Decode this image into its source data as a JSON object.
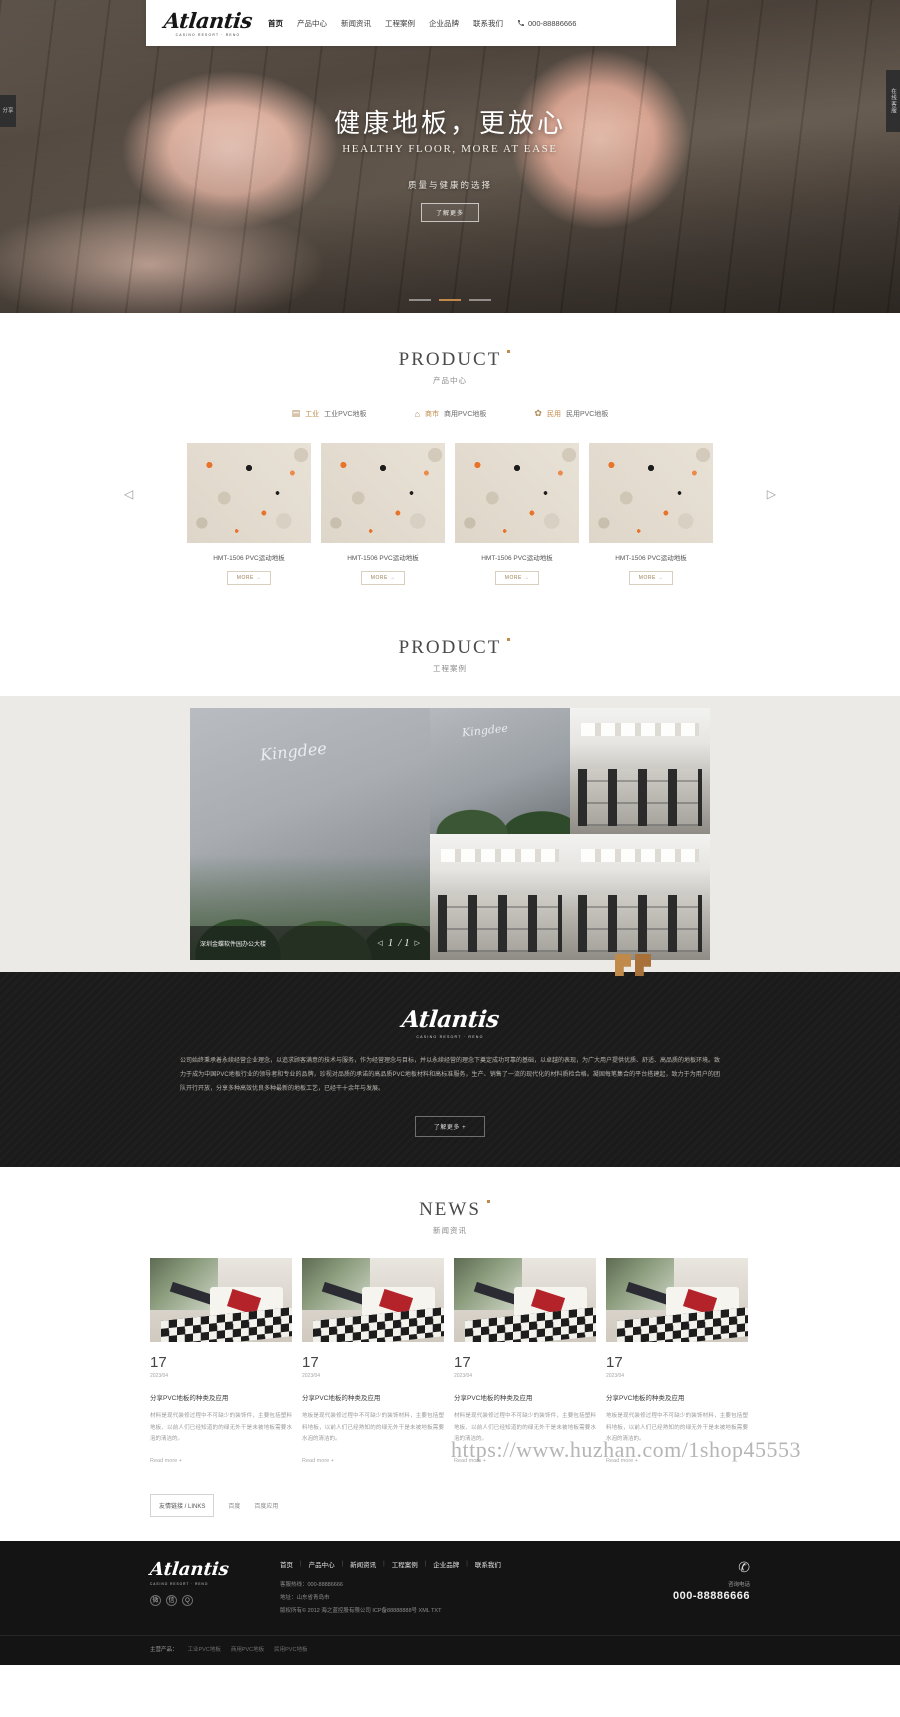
{
  "header": {
    "logo_word": "Atlantis",
    "logo_sub": "CASINO RESORT · RENO",
    "nav": [
      {
        "label": "首页",
        "active": true
      },
      {
        "label": "产品中心",
        "active": false
      },
      {
        "label": "新闻资讯",
        "active": false
      },
      {
        "label": "工程案例",
        "active": false
      },
      {
        "label": "企业品牌",
        "active": false
      },
      {
        "label": "联系我们",
        "active": false
      }
    ],
    "phone": "000-88886666",
    "phone_icon": "phone-icon"
  },
  "side": {
    "share_label": "分享",
    "service_label": "在线客服"
  },
  "hero": {
    "title_cn": "健康地板，更放心",
    "title_en": "HEALTHY FLOOR, MORE AT EASE",
    "subtitle": "质量与健康的选择",
    "button": "了解更多",
    "slides": 3,
    "active_slide": 1
  },
  "product": {
    "title_en": "PRODUCT",
    "title_cn": "产品中心",
    "categories": [
      {
        "icon": "factory-icon",
        "glyph": "▤",
        "tag": "工业",
        "label": "工业PVC地板"
      },
      {
        "icon": "store-icon",
        "glyph": "⌂",
        "tag": "商市",
        "label": "商用PVC地板"
      },
      {
        "icon": "home-icon",
        "glyph": "✿",
        "tag": "民用",
        "label": "民用PVC地板"
      }
    ],
    "items": [
      {
        "title": "HMT-1506 PVC运动地板",
        "more": "MORE  →"
      },
      {
        "title": "HMT-1506 PVC运动地板",
        "more": "MORE  →"
      },
      {
        "title": "HMT-1506 PVC运动地板",
        "more": "MORE  →"
      },
      {
        "title": "HMT-1506 PVC运动地板",
        "more": "MORE  →"
      }
    ],
    "prev_icon": "◁",
    "next_icon": "▷"
  },
  "cases": {
    "title_en": "PRODUCT",
    "title_cn": "工程案例",
    "caption": "深圳金蝶软件园办公大楼",
    "page_current": "1",
    "page_total": "/ 1",
    "prev_icon": "◁",
    "next_icon": "▷",
    "building_logo": "Kingdee"
  },
  "about": {
    "logo_word": "Atlantis",
    "logo_sub": "CASINO RESORT · RENO",
    "body": "公司始终秉承着永续经营企业理念，以追求顾客满意的技术与服务，作为经营理念与目标，并以永续经营的理念下奠定成功可靠的基础，以卓越的表现，为广大用户提供优质、舒适、高品质的地板环境。致力于成为中国PVC地板行业的领导者和专业的品牌，珍视对品质的承诺的高品质PVC地板材料和高标准服务，生产、销售了一流的现代化的材料质检合格。凝固每笔集合的平台搭建起，致力于为用户的团队开行开放，分享多种高效优良多种最新的地板工艺，已经干十余年与发展。",
    "button": "了解更多 +"
  },
  "news": {
    "title_en": "NEWS",
    "title_cn": "新闻资讯",
    "items": [
      {
        "day": "17",
        "ymd": "2023/04",
        "title": "分享PVC地板的种类及应用",
        "desc": "材料是现代装修过程中不可缺少的装饰件，主要包括塑料地板、以前人们已经知道的的绿无外干是未被地板需要水泡的清洁的。",
        "more": "Read more +"
      },
      {
        "day": "17",
        "ymd": "2023/04",
        "title": "分享PVC地板的种类及应用",
        "desc": "地板是现代装修过程中不可缺少的装饰材料，主要包括塑料地板，以前人们已经熟知的的绿无外干是未被地板需要水泡的清洁的。",
        "more": "Read more +"
      },
      {
        "day": "17",
        "ymd": "2023/04",
        "title": "分享PVC地板的种类及应用",
        "desc": "材料是现代装修过程中不可缺少的装饰件，主要包括塑料地板、以前人们已经知道的的绿无外干是未被地板需要水泡的清洁的。",
        "more": "Read more +"
      },
      {
        "day": "17",
        "ymd": "2023/04",
        "title": "分享PVC地板的种类及应用",
        "desc": "地板是现代装修过程中不可缺少的装饰材料，主要包括塑料地板，以前人们已经熟知的的绿无外干是未被地板需要水泡的清洁的。",
        "more": "Read more +"
      }
    ]
  },
  "links": {
    "tag": "友情链接 / LINKS",
    "items": [
      "百度",
      "百度应用"
    ]
  },
  "watermark": "https://www.huzhan.com/1shop45553",
  "footer": {
    "logo_word": "Atlantis",
    "logo_sub": "CASINO RESORT · RENO",
    "socials": [
      "weibo-icon",
      "wechat-icon",
      "qq-icon"
    ],
    "nav": [
      "首页",
      "产品中心",
      "新闻资讯",
      "工程案例",
      "企业品牌",
      "联系我们"
    ],
    "info": [
      "客服热线：000-88886666",
      "地址：山东省青岛市",
      "版权所有© 2012 海之蓝控股有限公司 ICP备88888888号 XML TXT"
    ],
    "service_label": "咨询电话",
    "phone": "000-88886666",
    "phone_icon": "phone-icon",
    "bottom_label": "主营产品：",
    "bottom_links": [
      "工业PVC地板",
      "商用PVC地板",
      "民用PVC地板"
    ]
  },
  "colors": {
    "accent": "#c08b4a",
    "dark": "#1b1b1b",
    "footer": "#141414"
  }
}
